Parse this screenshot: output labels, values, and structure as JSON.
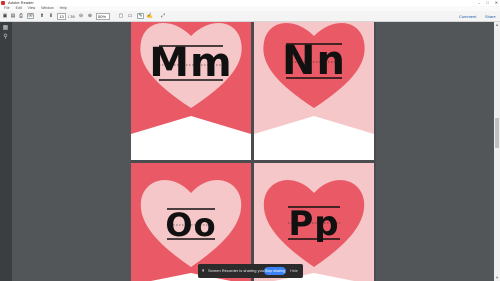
{
  "window": {
    "title": "Adobe Reader",
    "controls": [
      "–",
      "□",
      "✕"
    ]
  },
  "menu": [
    "File",
    "Edit",
    "View",
    "Window",
    "Help"
  ],
  "toolbar": {
    "page_current": "13",
    "page_total": "/ 39",
    "zoom": "50%",
    "comment_label": "Comment",
    "share_label": "Share"
  },
  "cards": [
    {
      "letters": "Mm",
      "heart_color": "#f6c7c9",
      "bg_color": "#ea5a66",
      "chevron": "#ffffff"
    },
    {
      "letters": "Nn",
      "heart_color": "#ea5a66",
      "bg_color": "#f6c7c9",
      "chevron": "#ffffff"
    },
    {
      "letters": "Oo",
      "heart_color": "#f6c7c9",
      "bg_color": "#ea5a66",
      "chevron": "#ffffff"
    },
    {
      "letters": "Pp",
      "heart_color": "#ea5a66",
      "bg_color": "#f6c7c9",
      "chevron": "#ffffff"
    }
  ],
  "recorder": {
    "message": "Screen Recorder is sharing your screen.",
    "stop_label": "Stop sharing",
    "hide_label": "Hide"
  }
}
